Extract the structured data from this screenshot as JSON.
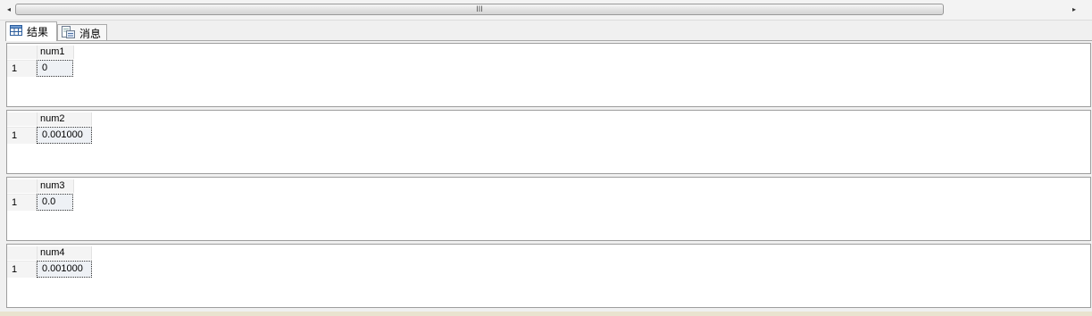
{
  "scrollbar": {
    "left_arrow": "◂",
    "right_arrow": "▸",
    "grip": "III"
  },
  "tabs": [
    {
      "label": "结果",
      "icon": "grid-icon",
      "active": true
    },
    {
      "label": "消息",
      "icon": "messages-icon",
      "active": false
    }
  ],
  "results": [
    {
      "column": "num1",
      "row_number": "1",
      "value": "0"
    },
    {
      "column": "num2",
      "row_number": "1",
      "value": "0.001000"
    },
    {
      "column": "num3",
      "row_number": "1",
      "value": "0.0"
    },
    {
      "column": "num4",
      "row_number": "1",
      "value": "0.001000"
    }
  ]
}
